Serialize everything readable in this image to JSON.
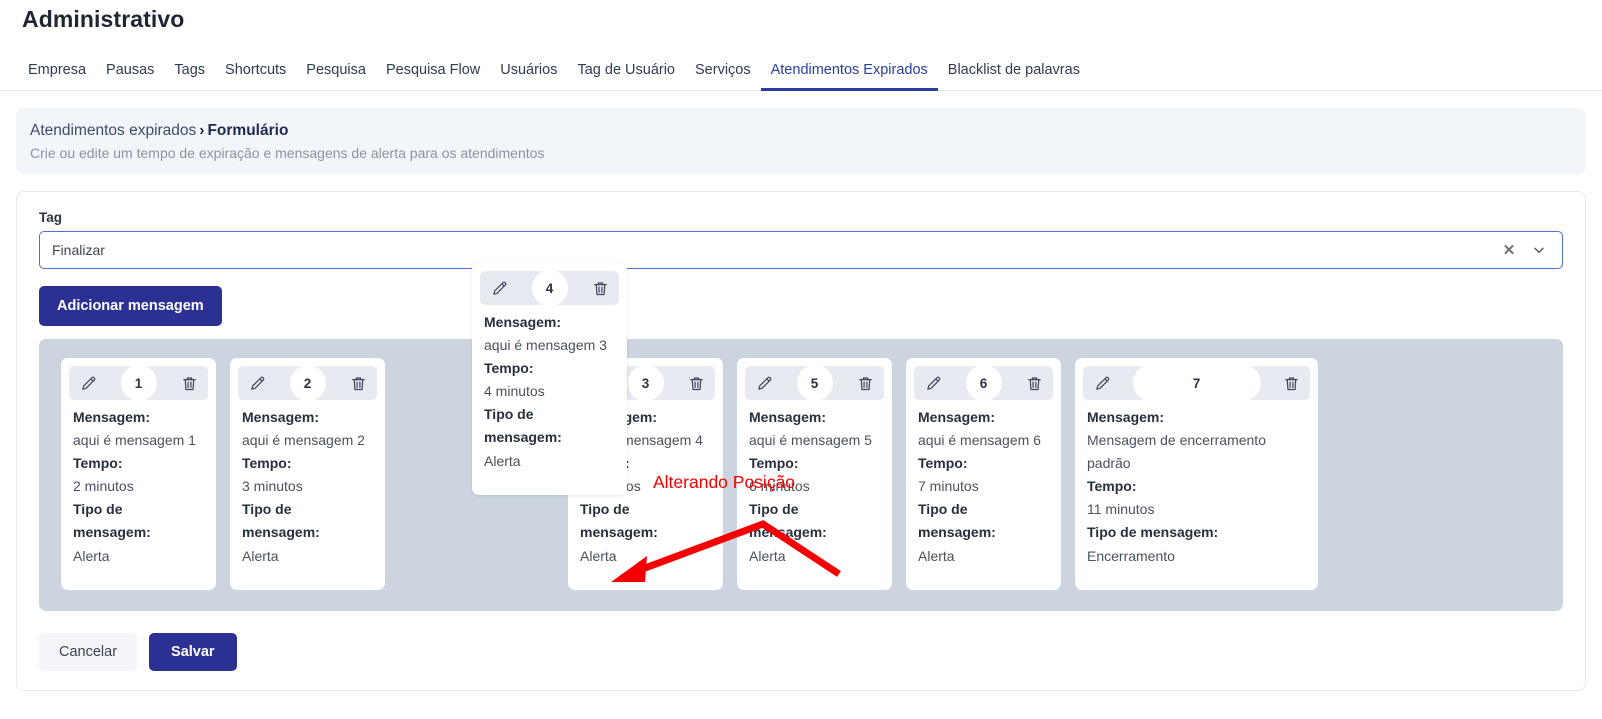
{
  "header": {
    "title": "Administrativo",
    "tabs": [
      {
        "label": "Empresa",
        "active": false
      },
      {
        "label": "Pausas",
        "active": false
      },
      {
        "label": "Tags",
        "active": false
      },
      {
        "label": "Shortcuts",
        "active": false
      },
      {
        "label": "Pesquisa",
        "active": false
      },
      {
        "label": "Pesquisa Flow",
        "active": false
      },
      {
        "label": "Usuários",
        "active": false
      },
      {
        "label": "Tag de Usuário",
        "active": false
      },
      {
        "label": "Serviços",
        "active": false
      },
      {
        "label": "Atendimentos Expirados",
        "active": true
      },
      {
        "label": "Blacklist de palavras",
        "active": false
      }
    ]
  },
  "breadcrumb": {
    "parent": "Atendimentos expirados",
    "separator": "›",
    "current": "Formulário",
    "subtitle": "Crie ou edite um tempo de expiração e mensagens de alerta para os atendimentos"
  },
  "form": {
    "tag_label": "Tag",
    "tag_value": "Finalizar",
    "tag_clear_icon": "close-x-icon",
    "tag_chevron_icon": "chevron-down-icon",
    "add_button_label": "Adicionar mensagem",
    "cancel_button_label": "Cancelar",
    "save_button_label": "Salvar"
  },
  "card_labels": {
    "message": "Mensagem:",
    "time": "Tempo:",
    "type": "Tipo de mensagem:",
    "edit_icon": "pencil-icon",
    "delete_icon": "trash-icon"
  },
  "cards": [
    {
      "position": "1",
      "message": "aqui é mensagem 1",
      "time": "2 minutos",
      "type": "Alerta"
    },
    {
      "position": "2",
      "message": "aqui é mensagem 2",
      "time": "3 minutos",
      "type": "Alerta"
    },
    {
      "position": "3",
      "message": "aqui é mensagem 4",
      "time": "5 minutos",
      "type": "Alerta"
    },
    {
      "position": "5",
      "message": "aqui é mensagem 5",
      "time": "6 minutos",
      "type": "Alerta"
    },
    {
      "position": "6",
      "message": "aqui é mensagem 6",
      "time": "7 minutos",
      "type": "Alerta"
    },
    {
      "position": "7",
      "message": "Mensagem de encerramento padrão",
      "time": "11 minutos",
      "type": "Encerramento"
    }
  ],
  "dragged_card": {
    "position": "4",
    "message": "aqui é mensagem 3",
    "time": "4 minutos",
    "type": "Alerta"
  },
  "annotation": {
    "text": "Alterando Posição",
    "color": "#f50000"
  },
  "colors": {
    "primary": "#2b3193",
    "tab_active": "#2a3fa0",
    "drop_zone": "#ccd4e0",
    "card_head": "#e7ebf1",
    "breadcrumb_panel": "#f2f5fa"
  }
}
